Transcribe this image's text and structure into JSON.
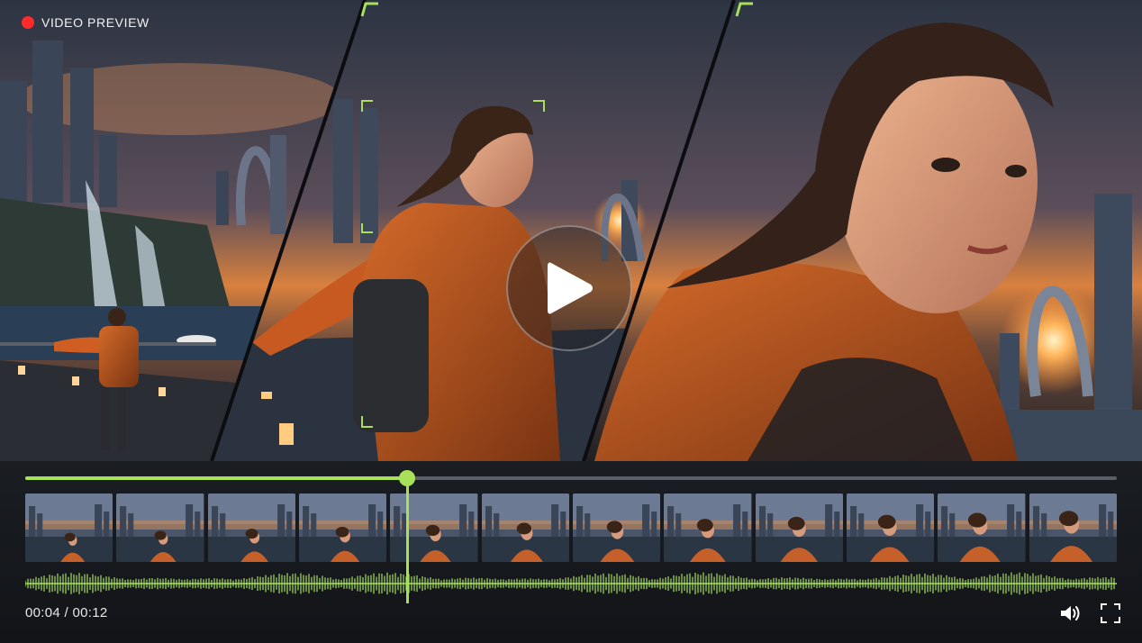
{
  "header": {
    "label": "VIDEO PREVIEW"
  },
  "player": {
    "current_time": "00:04",
    "separator": "/",
    "duration": "00:12",
    "progress": 0.35
  },
  "timeline": {
    "frame_count": 12
  },
  "icons": {
    "record": "record-dot-icon",
    "play": "play-icon",
    "volume": "volume-icon",
    "fullscreen": "fullscreen-icon"
  },
  "colors": {
    "accent": "#a8e05a",
    "record": "#ff2a2a"
  }
}
